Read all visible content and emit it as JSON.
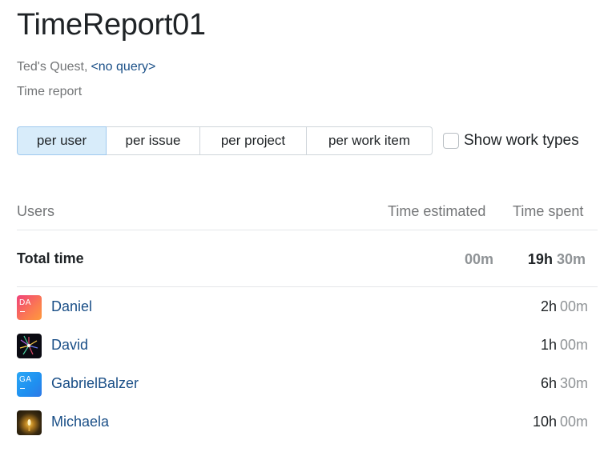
{
  "title": "TimeReport01",
  "project": "Ted's Quest,",
  "query": "<no query>",
  "report_type": "Time report",
  "tabs": [
    "per user",
    "per issue",
    "per project",
    "per work item"
  ],
  "active_tab": "per user",
  "show_work_types": {
    "label": "Show work types",
    "checked": false
  },
  "columns": {
    "users": "Users",
    "estimated": "Time estimated",
    "spent": "Time spent"
  },
  "total": {
    "label": "Total time",
    "estimated": "00m",
    "spent_h": "19h",
    "spent_m": "30m"
  },
  "users": [
    {
      "name": "Daniel",
      "initials": "DA",
      "avatar": "gradient-pink-orange",
      "spent_h": "2h",
      "spent_m": "00m"
    },
    {
      "name": "David",
      "initials": "",
      "avatar": "fireworks-photo",
      "spent_h": "1h",
      "spent_m": "00m"
    },
    {
      "name": "GabrielBalzer",
      "initials": "GA",
      "avatar": "gradient-blue",
      "spent_h": "6h",
      "spent_m": "30m"
    },
    {
      "name": "Michaela",
      "initials": "",
      "avatar": "candle-photo",
      "spent_h": "10h",
      "spent_m": "00m"
    }
  ],
  "colors": {
    "link": "#1a4f87",
    "active_tab_bg": "#d8ecfa",
    "muted": "#737577"
  }
}
